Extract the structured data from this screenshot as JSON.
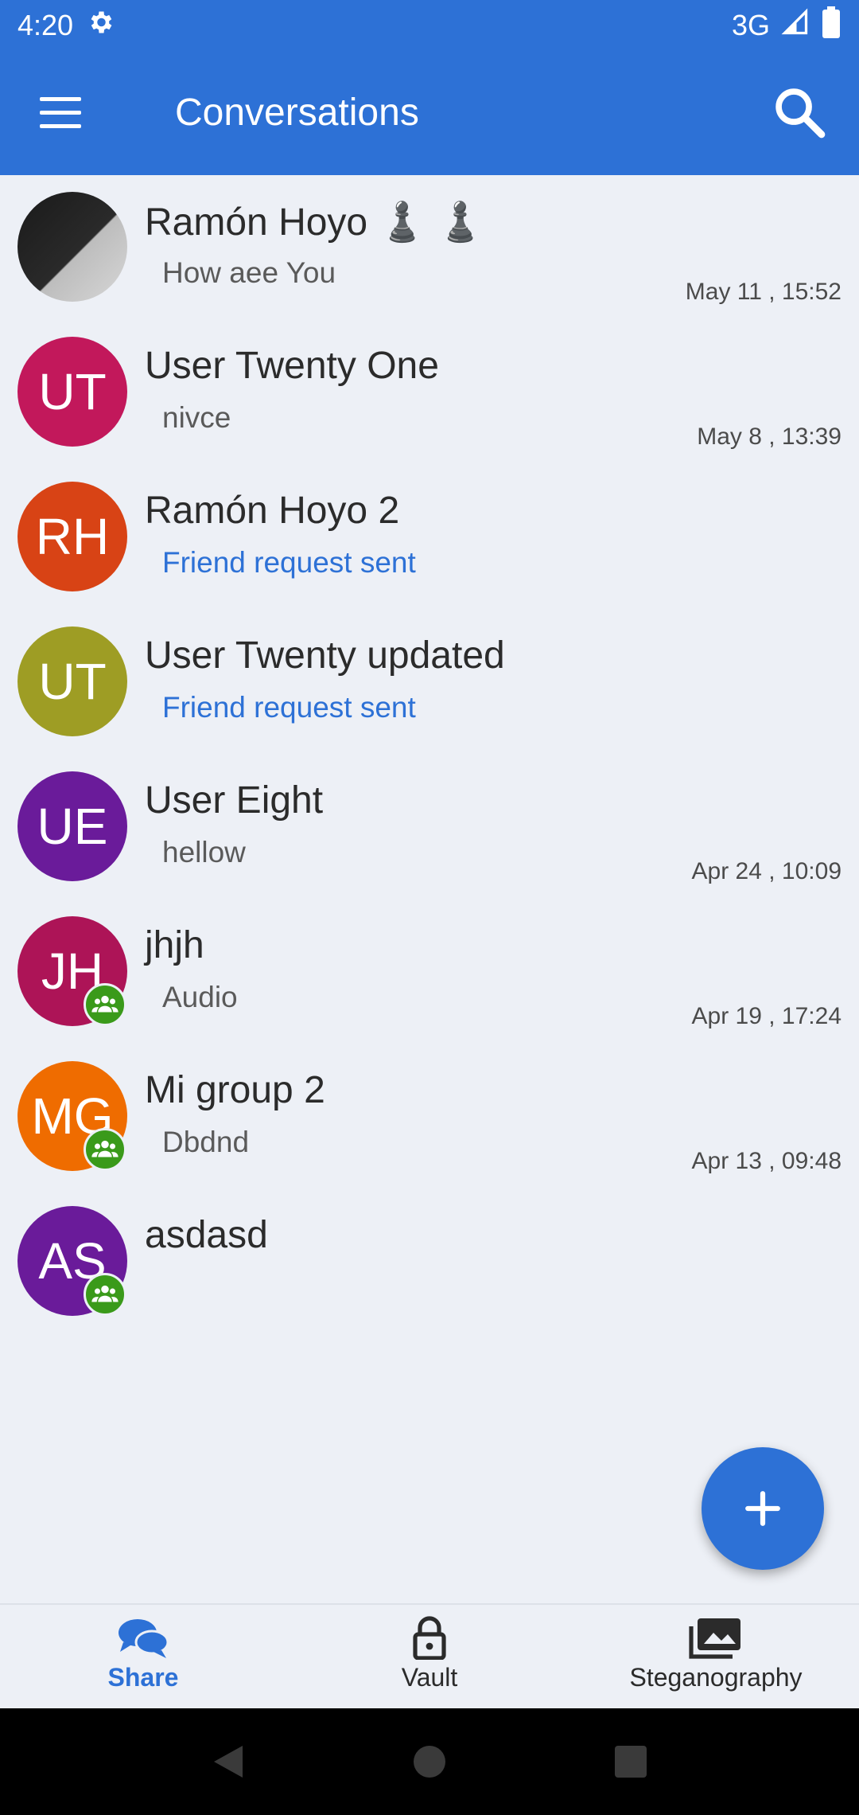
{
  "status_bar": {
    "time": "4:20",
    "network": "3G",
    "icons": [
      "settings-icon",
      "signal-icon",
      "battery-icon"
    ]
  },
  "app_bar": {
    "title": "Conversations",
    "icons": [
      "menu-icon",
      "search-icon"
    ]
  },
  "conversations": [
    {
      "name": "Ramón Hoyo ♟️ ♟️",
      "message": "How aee You",
      "time": "May 11 , 15:52",
      "initials": "",
      "avatar_color": "#222222",
      "group": false
    },
    {
      "name": "User Twenty One",
      "message": "nivce",
      "time": "May 8 , 13:39",
      "initials": "UT",
      "avatar_color": "#c2185b",
      "group": false
    },
    {
      "name": "Ramón Hoyo 2",
      "message": "Friend request sent",
      "time": "",
      "initials": "RH",
      "avatar_color": "#d84315",
      "group": false
    },
    {
      "name": "User Twenty updated",
      "message": "Friend request sent",
      "time": "",
      "initials": "UT",
      "avatar_color": "#9e9d24",
      "group": false
    },
    {
      "name": "User Eight",
      "message": "hellow",
      "time": "Apr 24 , 10:09",
      "initials": "UE",
      "avatar_color": "#6a1b9a",
      "group": false
    },
    {
      "name": "jhjh",
      "message": "Audio",
      "time": "Apr 19 , 17:24",
      "initials": "JH",
      "avatar_color": "#ad1457",
      "group": true
    },
    {
      "name": "Mi group 2",
      "message": "Dbdnd",
      "time": "Apr 13 , 09:48",
      "initials": "MG",
      "avatar_color": "#ef6c00",
      "group": true
    },
    {
      "name": "asdasd",
      "message": "",
      "time": "",
      "initials": "AS",
      "avatar_color": "#6a1b9a",
      "group": true
    }
  ],
  "fab": {
    "icon": "plus-icon"
  },
  "bottom_nav": [
    {
      "label": "Share",
      "icon": "chat-bubbles-icon",
      "active": true
    },
    {
      "label": "Vault",
      "icon": "lock-icon",
      "active": false
    },
    {
      "label": "Steganography",
      "icon": "images-icon",
      "active": false
    }
  ],
  "colors": {
    "primary": "#2d71d6",
    "background": "#edf0f6",
    "group_badge": "#3a9a1a"
  }
}
